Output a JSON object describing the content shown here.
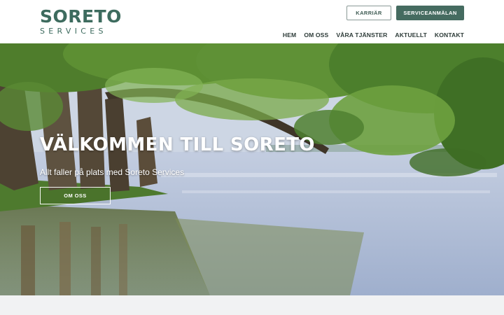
{
  "brand": {
    "name_main": "SORETO",
    "name_sub": "SERVICES",
    "color": "#3d6b5e"
  },
  "header": {
    "career_label": "KARRIÄR",
    "service_label": "SERVICEANMÄLAN",
    "nav": [
      {
        "label": "HEM"
      },
      {
        "label": "OM OSS"
      },
      {
        "label": "VÅRA TJÄNSTER"
      },
      {
        "label": "AKTUELLT"
      },
      {
        "label": "KONTAKT"
      }
    ]
  },
  "hero": {
    "title": "VÄLKOMMEN TILL SORETO",
    "subtitle": "Allt faller på plats med Soreto Services",
    "button_label": "OM OSS"
  },
  "colors": {
    "accent": "#456b60",
    "nav_text": "#2d3b38"
  }
}
